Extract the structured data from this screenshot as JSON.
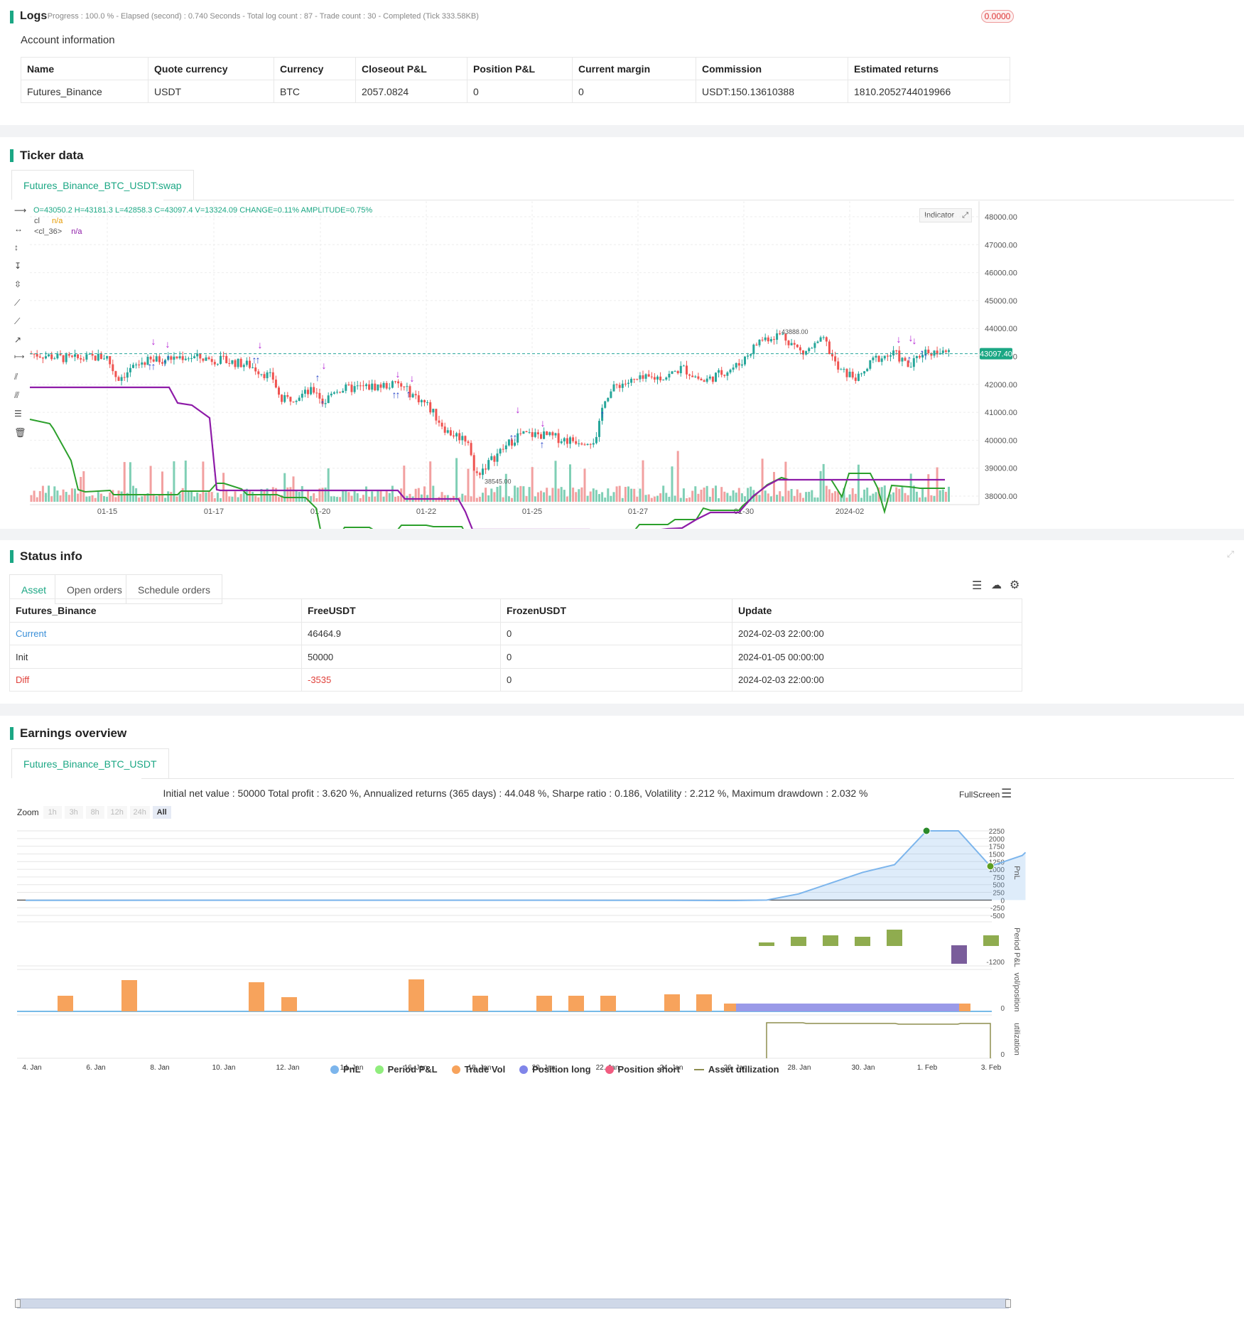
{
  "logs": {
    "title": "Logs",
    "status": "- Progress : 100.0 % - Elapsed (second) : 0.740  Seconds - Total log count : 87 - Trade count : 30 - Completed (Tick 333.58KB)",
    "badge": "0.0000"
  },
  "account": {
    "title": "Account information",
    "columns": [
      "Name",
      "Quote currency",
      "Currency",
      "Closeout P&L",
      "Position P&L",
      "Current margin",
      "Commission",
      "Estimated returns"
    ],
    "row": [
      "Futures_Binance",
      "USDT",
      "BTC",
      "2057.0824",
      "0",
      "0",
      "USDT:150.13610388",
      "1810.2052744019966"
    ]
  },
  "ticker": {
    "title": "Ticker data",
    "tab": "Futures_Binance_BTC_USDT:swap",
    "ohlc": "O=43050.2 H=43181.3 L=42858.3 C=43097.4 V=13324.09 CHANGE=0.11% AMPLITUDE=0.75%",
    "legend1_name": "cl",
    "legend1_val": "n/a",
    "legend2_name": "<cl_36>",
    "legend2_val": "n/a",
    "indicator_btn": "Indicator",
    "price_tag": "43097.40",
    "y_ticks": [
      "48000.00",
      "47000.00",
      "46000.00",
      "45000.00",
      "44000.00",
      "43000.00",
      "42000.00",
      "41000.00",
      "40000.00",
      "39000.00",
      "38000.00"
    ],
    "x_ticks": [
      "01-15",
      "01-17",
      "01-20",
      "01-22",
      "01-25",
      "01-27",
      "01-30",
      "2024-02"
    ],
    "high_label": "43888.00",
    "low_label": "38545.00",
    "colors": {
      "green_line": "#2ca02c",
      "purple_line": "#8e1ba8",
      "up": "#26a69a",
      "down": "#ef5350"
    }
  },
  "status": {
    "title": "Status info",
    "tabs": [
      "Asset",
      "Open orders",
      "Schedule orders"
    ],
    "columns": [
      "Futures_Binance",
      "FreeUSDT",
      "FrozenUSDT",
      "Update"
    ],
    "rows": [
      [
        "Current",
        "46464.9",
        "0",
        "2024-02-03 22:00:00"
      ],
      [
        "Init",
        "50000",
        "0",
        "2024-01-05 00:00:00"
      ],
      [
        "Diff",
        "-3535",
        "0",
        "2024-02-03 22:00:00"
      ]
    ]
  },
  "earnings": {
    "title": "Earnings overview",
    "tab": "Futures_Binance_BTC_USDT",
    "summary": "Initial net value : 50000 Total profit : 3.620 %, Annualized returns (365 days) : 44.048 %, Sharpe ratio : 0.186, Volatility : 2.212 %, Maximum drawdown : 2.032 %",
    "fullscreen": "FullScreen",
    "zoom_label": "Zoom",
    "zoom_buttons": [
      "1h",
      "3h",
      "8h",
      "12h",
      "24h",
      "All"
    ],
    "pnl_ticks": [
      "2250",
      "2000",
      "1750",
      "1500",
      "1250",
      "1000",
      "750",
      "500",
      "250",
      "0",
      "-250",
      "-500"
    ],
    "axis_labels": [
      "PnL",
      "Period P&L",
      "vol/position",
      "utilization"
    ],
    "period_tick": "-1200",
    "x_ticks": [
      "4. Jan",
      "6. Jan",
      "8. Jan",
      "10. Jan",
      "12. Jan",
      "14. Jan",
      "16. Jan",
      "18. Jan",
      "20. Jan",
      "22. Jan",
      "24. Jan",
      "26. Jan",
      "28. Jan",
      "30. Jan",
      "1. Feb",
      "3. Feb"
    ],
    "legend": [
      "PnL",
      "Period P&L",
      "Trade Vol",
      "Position long",
      "Position short",
      "Asset utilization"
    ],
    "legend_colors": [
      "#7cb5ec",
      "#90ed7d",
      "#f7a35c",
      "#8085e9",
      "#f15c80",
      "#8d8d4f"
    ]
  }
}
